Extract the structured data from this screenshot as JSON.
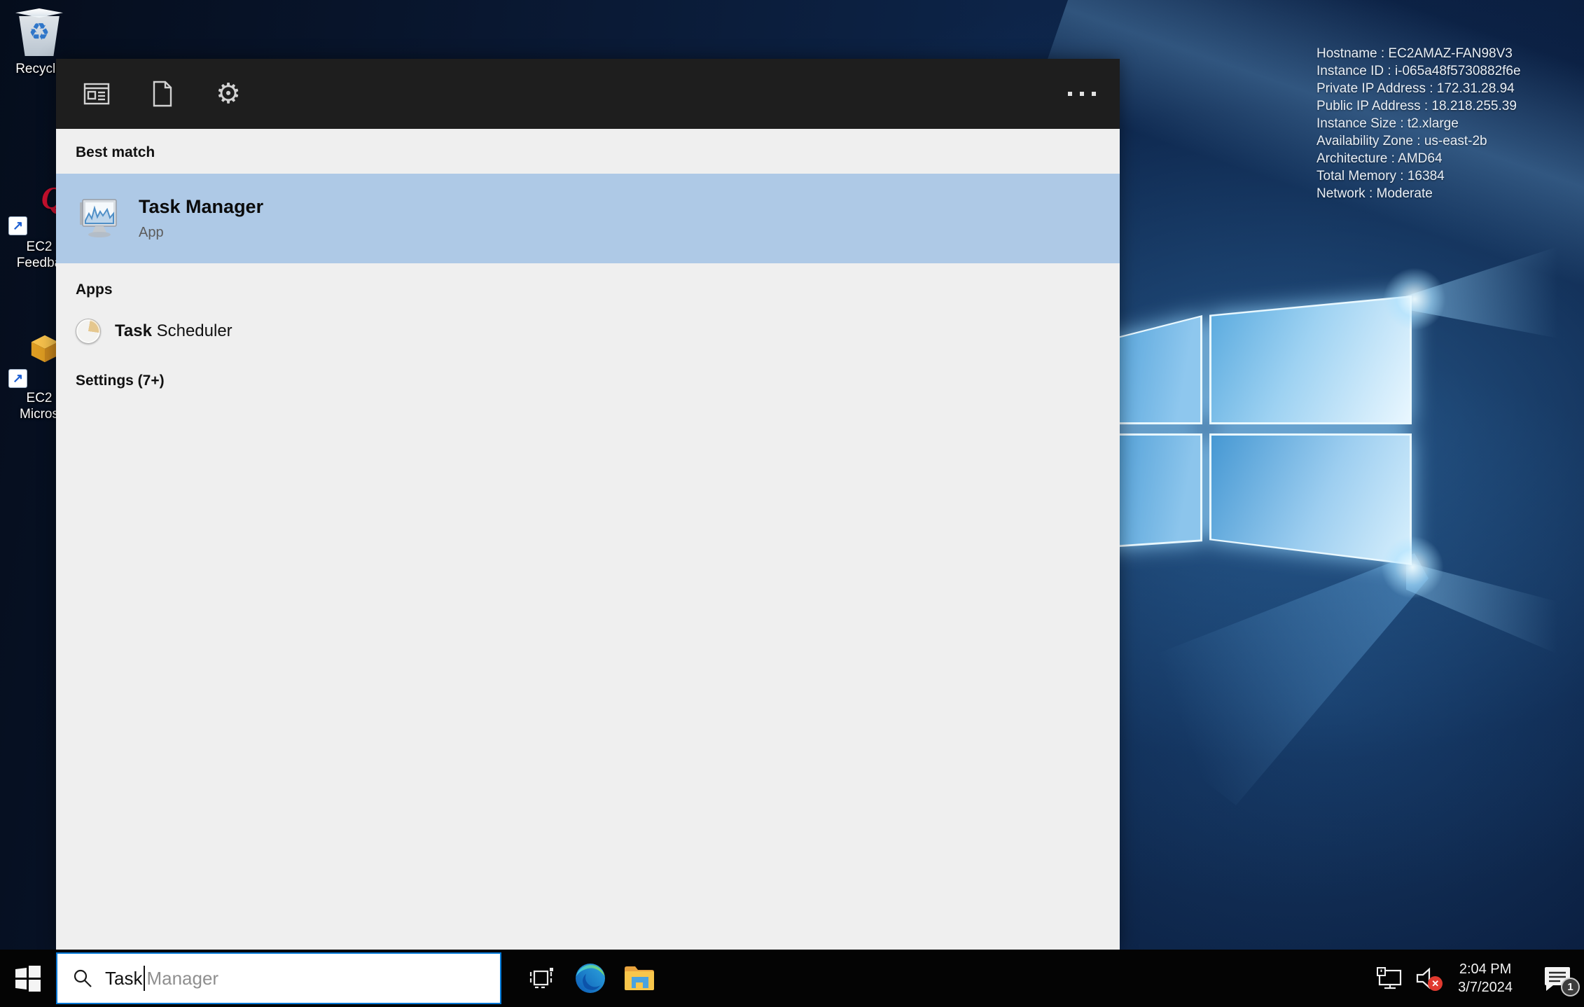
{
  "colors": {
    "accent": "#0078d7",
    "best_match_highlight": "#aec9e6",
    "flyout_header": "#1e1e1e",
    "flyout_body": "#efefef",
    "taskbar": "#040404"
  },
  "desktop": {
    "instance_info": [
      "Hostname : EC2AMAZ-FAN98V3",
      "Instance ID : i-065a48f5730882f6e",
      "Private IP Address : 172.31.28.94",
      "Public IP Address : 18.218.255.39",
      "Instance Size : t2.xlarge",
      "Availability Zone : us-east-2b",
      "Architecture : AMD64",
      "Total Memory : 16384",
      "Network : Moderate"
    ],
    "icons": [
      {
        "id": "recycle-bin",
        "lines": [
          "Recycle"
        ]
      },
      {
        "id": "ec2-feedback",
        "lines": [
          "EC2",
          "Feedba"
        ]
      },
      {
        "id": "ec2-microsoft",
        "lines": [
          "EC2",
          "Micros"
        ]
      }
    ]
  },
  "search_flyout": {
    "sections": {
      "best_match": {
        "label": "Best match",
        "result": {
          "title_match": "Task",
          "title_rest": " Manager",
          "subtitle": "App"
        }
      },
      "apps": {
        "label": "Apps",
        "result": {
          "title_match": "Task",
          "title_rest": " Scheduler"
        }
      },
      "settings": {
        "label": "Settings (7+)"
      }
    }
  },
  "taskbar": {
    "search": {
      "typed": "Task",
      "suggestion": "Manager"
    },
    "tray": {
      "time": "2:04 PM",
      "date": "3/7/2024",
      "notification_count": "1"
    }
  }
}
